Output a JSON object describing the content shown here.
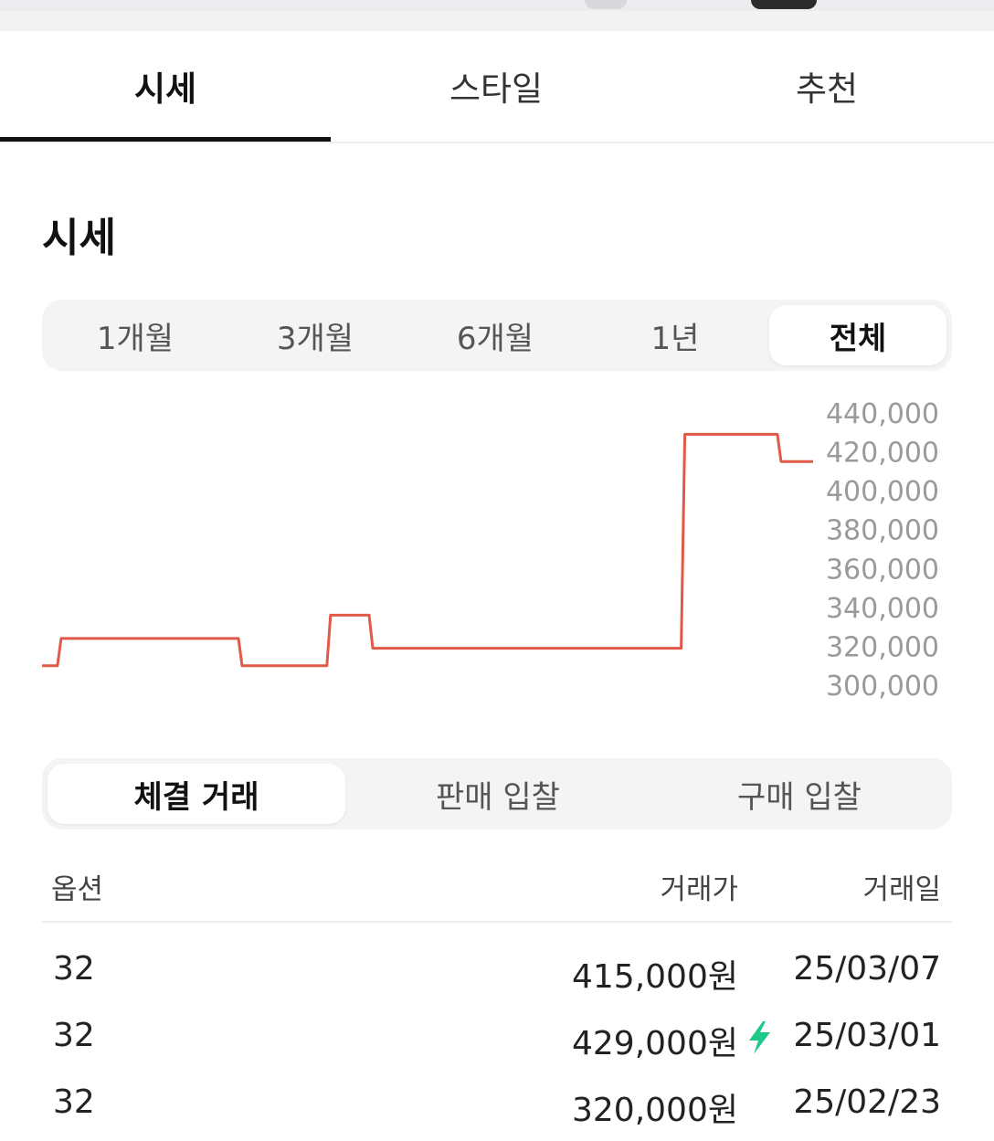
{
  "tabs": [
    {
      "label": "시세",
      "active": true
    },
    {
      "label": "스타일",
      "active": false
    },
    {
      "label": "추천",
      "active": false
    }
  ],
  "section_title": "시세",
  "period_options": [
    {
      "label": "1개월",
      "active": false
    },
    {
      "label": "3개월",
      "active": false
    },
    {
      "label": "6개월",
      "active": false
    },
    {
      "label": "1년",
      "active": false
    },
    {
      "label": "전체",
      "active": true
    }
  ],
  "chart_data": {
    "type": "line",
    "line_color": "#e05a47",
    "ylim": [
      300000,
      440000
    ],
    "y_ticks": [
      "440,000",
      "420,000",
      "400,000",
      "380,000",
      "360,000",
      "340,000",
      "320,000",
      "300,000"
    ],
    "series": [
      {
        "step_values": [
          310000,
          324000,
          310000,
          336000,
          319000,
          429000,
          415000
        ],
        "segment_fractions": [
          0.02,
          0.23,
          0.11,
          0.05,
          0.4,
          0.12
        ]
      }
    ]
  },
  "trade_tabs": [
    {
      "label": "체결 거래",
      "active": true
    },
    {
      "label": "판매 입찰",
      "active": false
    },
    {
      "label": "구매 입찰",
      "active": false
    }
  ],
  "table": {
    "headers": {
      "option": "옵션",
      "price": "거래가",
      "date": "거래일"
    },
    "rows": [
      {
        "option": "32",
        "price": "415,000원",
        "date": "25/03/07",
        "quick": false
      },
      {
        "option": "32",
        "price": "429,000원",
        "date": "25/03/01",
        "quick": true
      },
      {
        "option": "32",
        "price": "320,000원",
        "date": "25/02/23",
        "quick": false
      }
    ]
  },
  "colors": {
    "accent_line": "#e05a47",
    "quick_icon": "#1ec98a"
  },
  "icons": {
    "quick": "lightning-bolt-icon"
  }
}
